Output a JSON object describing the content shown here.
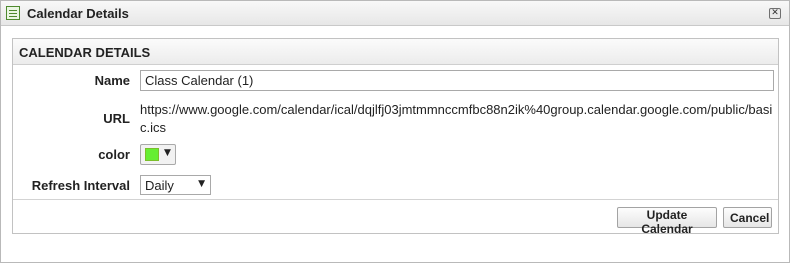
{
  "window": {
    "title": "Calendar Details",
    "icon": "calendar-list-icon",
    "close_glyph": "✕"
  },
  "panel": {
    "header": "CALENDAR DETAILS"
  },
  "form": {
    "name_label": "Name",
    "name_value": "Class Calendar (1)",
    "url_label": "URL",
    "url_value": "https://www.google.com/calendar/ical/dqjlfj03jmtmmnccmfbc88n2ik%40group.calendar.google.com/public/basic.ics",
    "color_label": "color",
    "color_value": "#66ee33",
    "color_caret": "▼",
    "refresh_label": "Refresh Interval",
    "refresh_value": "Daily",
    "refresh_caret": "▼"
  },
  "buttons": {
    "update": "Update Calendar",
    "cancel": "Cancel"
  }
}
